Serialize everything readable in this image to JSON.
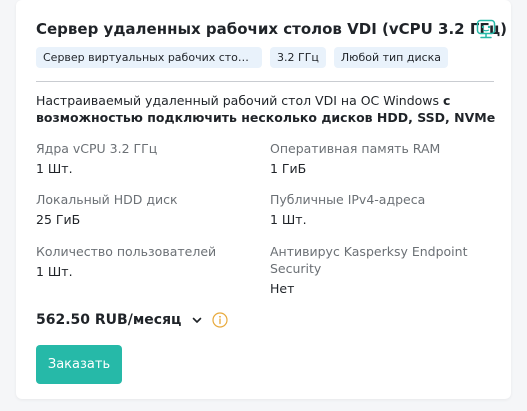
{
  "card": {
    "title": "Сервер удаленных рабочих столов VDI (vCPU 3.2 ГГц)",
    "icon": "vdi-monitor-icon",
    "accent_color": "#26b9a8",
    "tags": [
      "Сервер виртуальных рабочих столов ...",
      "3.2 ГГц",
      "Любой тип диска"
    ],
    "description_plain": "Настраиваемый удаленный рабочий стол VDI на ОС Windows",
    "description_bold_1": "с",
    "description_bold_2": "возможностью подключить несколько дисков HDD, SSD, NVMe",
    "specs": [
      {
        "label": "Ядра vCPU 3.2 ГГц",
        "value": "1 Шт."
      },
      {
        "label": "Оперативная память RAM",
        "value": "1 ГиБ"
      },
      {
        "label": "Локальный HDD диск",
        "value": "25 ГиБ"
      },
      {
        "label": "Публичные IPv4-адреса",
        "value": "1 Шт."
      },
      {
        "label": "Количество пользователей",
        "value": "1 Шт."
      },
      {
        "label": "Антивирус Kasperksy Endpoint Security",
        "value": "Нет"
      }
    ],
    "price": "562.50 RUB/месяц",
    "order_label": "Заказать"
  }
}
